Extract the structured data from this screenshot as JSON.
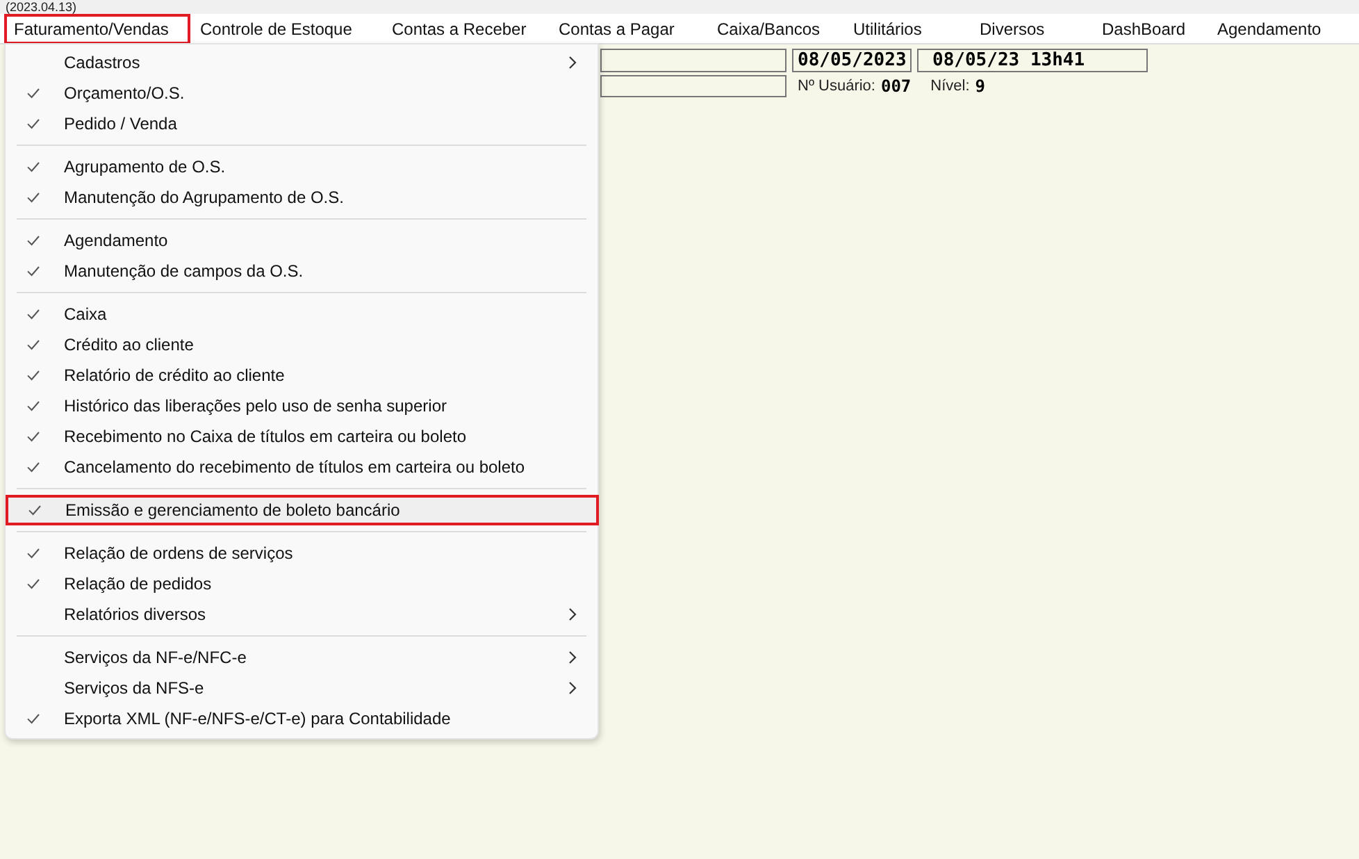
{
  "window": {
    "title": "(2023.04.13)"
  },
  "menu_bar": [
    {
      "label": "Faturamento/Vendas",
      "selected": true
    },
    {
      "label": "Controle de Estoque",
      "selected": false
    },
    {
      "label": "Contas a Receber",
      "selected": false
    },
    {
      "label": "Contas a Pagar",
      "selected": false
    },
    {
      "label": "Caixa/Bancos",
      "selected": false
    },
    {
      "label": "Utilitários",
      "selected": false
    },
    {
      "label": "Diversos",
      "selected": false
    },
    {
      "label": "DashBoard",
      "selected": false
    },
    {
      "label": "Agendamento",
      "selected": false
    }
  ],
  "header": {
    "date": "08/05/2023",
    "datetime": "08/05/23 13h41",
    "user_label": "Nº Usuário:",
    "user_value": "007",
    "level_label": "Nível:",
    "level_value": "9"
  },
  "dropdown_menu": {
    "groups": [
      [
        {
          "label": "Cadastros",
          "checked": false,
          "submenu": true,
          "selected": false
        },
        {
          "label": "Orçamento/O.S.",
          "checked": true,
          "submenu": false,
          "selected": false
        },
        {
          "label": "Pedido / Venda",
          "checked": true,
          "submenu": false,
          "selected": false
        }
      ],
      [
        {
          "label": "Agrupamento de O.S.",
          "checked": true,
          "submenu": false,
          "selected": false
        },
        {
          "label": "Manutenção do Agrupamento de O.S.",
          "checked": true,
          "submenu": false,
          "selected": false
        }
      ],
      [
        {
          "label": "Agendamento",
          "checked": true,
          "submenu": false,
          "selected": false
        },
        {
          "label": "Manutenção de campos da O.S.",
          "checked": true,
          "submenu": false,
          "selected": false
        }
      ],
      [
        {
          "label": "Caixa",
          "checked": true,
          "submenu": false,
          "selected": false
        },
        {
          "label": "Crédito ao cliente",
          "checked": true,
          "submenu": false,
          "selected": false
        },
        {
          "label": "Relatório de crédito ao cliente",
          "checked": true,
          "submenu": false,
          "selected": false
        },
        {
          "label": "Histórico das liberações pelo uso de senha superior",
          "checked": true,
          "submenu": false,
          "selected": false
        },
        {
          "label": "Recebimento no Caixa de títulos em carteira ou boleto",
          "checked": true,
          "submenu": false,
          "selected": false
        },
        {
          "label": "Cancelamento do recebimento de títulos em carteira ou boleto",
          "checked": true,
          "submenu": false,
          "selected": false
        }
      ],
      [
        {
          "label": "Emissão e gerenciamento de boleto bancário",
          "checked": true,
          "submenu": false,
          "selected": true
        }
      ],
      [
        {
          "label": "Relação de ordens de serviços",
          "checked": true,
          "submenu": false,
          "selected": false
        },
        {
          "label": "Relação de pedidos",
          "checked": true,
          "submenu": false,
          "selected": false
        },
        {
          "label": "Relatórios diversos",
          "checked": false,
          "submenu": true,
          "selected": false
        }
      ],
      [
        {
          "label": "Serviços da NF-e/NFC-e",
          "checked": false,
          "submenu": true,
          "selected": false
        },
        {
          "label": "Serviços da NFS-e",
          "checked": false,
          "submenu": true,
          "selected": false
        },
        {
          "label": "Exporta XML (NF-e/NFS-e/CT-e) para Contabilidade",
          "checked": true,
          "submenu": false,
          "selected": false
        }
      ]
    ]
  }
}
